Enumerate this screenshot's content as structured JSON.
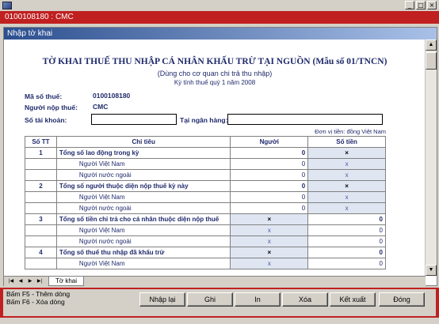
{
  "window": {
    "title": "0100108180 : CMC"
  },
  "child": {
    "title": "Nhập tờ khai"
  },
  "form": {
    "title": "TỜ KHAI THUẾ THU NHẬP CÁ NHÂN KHẤU TRỪ TẠI NGUỒN (Mẫu số 01/TNCN)",
    "subtitle": "(Dùng cho cơ quan chi trả thu nhập)",
    "period": "Kỳ tính thuế quý 1 năm 2008",
    "tax_code_label": "Mã số thuế:",
    "tax_code": "0100108180",
    "payer_label": "Người nộp thuế:",
    "payer": "CMC",
    "account_label": "Số tài khoản:",
    "account_value": "",
    "bank_label": "Tại ngân hàng:",
    "bank_value": "",
    "unit": "Đơn vị tiền: đồng Việt Nam"
  },
  "table": {
    "headers": [
      "Số TT",
      "Chỉ tiêu",
      "Người",
      "Số tiền"
    ],
    "rows": [
      {
        "stt": "1",
        "label": "Tổng số lao động trong kỳ",
        "people": "0",
        "amount": "×",
        "bold": true
      },
      {
        "stt": "",
        "label": "Người Việt Nam",
        "people": "0",
        "amount": "x",
        "bold": false
      },
      {
        "stt": "",
        "label": "Người nước ngoài",
        "people": "0",
        "amount": "x",
        "bold": false
      },
      {
        "stt": "2",
        "label": "Tổng số người thuộc diện nộp thuế kỳ này",
        "people": "0",
        "amount": "×",
        "bold": true
      },
      {
        "stt": "",
        "label": "Người Việt Nam",
        "people": "0",
        "amount": "x",
        "bold": false
      },
      {
        "stt": "",
        "label": "Người nước ngoài",
        "people": "0",
        "amount": "x",
        "bold": false
      },
      {
        "stt": "3",
        "label": "Tổng số tiền chi trả cho cá nhân thuộc diện nộp thuế",
        "people": "×",
        "amount": "0",
        "bold": true
      },
      {
        "stt": "",
        "label": "Người Việt Nam",
        "people": "x",
        "amount": "0",
        "bold": false
      },
      {
        "stt": "",
        "label": "Người nước ngoài",
        "people": "x",
        "amount": "0",
        "bold": false
      },
      {
        "stt": "4",
        "label": "Tổng số thuế thu nhập đã khấu trừ",
        "people": "×",
        "amount": "0",
        "bold": true
      },
      {
        "stt": "",
        "label": "Người Việt Nam",
        "people": "x",
        "amount": "0",
        "bold": false
      }
    ]
  },
  "sheet_tab": "Tờ khai",
  "hints": [
    "Bấm F5 - Thêm dòng",
    "Bấm F6 - Xóa dòng"
  ],
  "buttons": {
    "reenter": "Nhập lại",
    "save": "Ghi",
    "print": "In",
    "delete": "Xóa",
    "export": "Kết xuất",
    "close": "Đóng"
  },
  "colors": {
    "title_red": "#c02020",
    "text_navy": "#1f2a6b",
    "shaded_cell": "#dfe6f2"
  }
}
